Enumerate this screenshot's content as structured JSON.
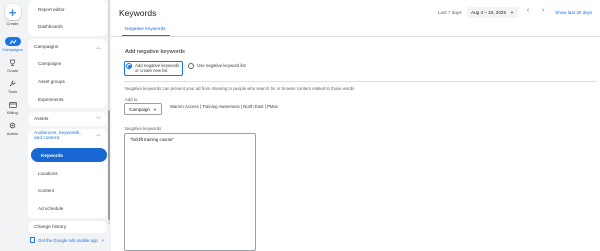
{
  "rail": {
    "create": "Create",
    "campaigns": "Campaigns",
    "goals": "Goals",
    "tools": "Tools",
    "billing": "Billing",
    "admin": "Admin"
  },
  "nav": {
    "top_items": [
      "Report editor",
      "Dashboards"
    ],
    "campaigns_section": "Campaigns",
    "campaigns_items": [
      "Campaigns",
      "Asset groups",
      "Experiments"
    ],
    "assets_section": "Assets",
    "akc_section": "Audiences, keywords, and content",
    "akc_items": [
      "Keywords",
      "Locations",
      "Content",
      "Ad schedule"
    ],
    "change_history": "Change history",
    "app_link": "Get the Google Ads mobile app"
  },
  "header": {
    "title": "Keywords",
    "date_range_label": "Last 7 days",
    "date_range_value": "Aug 4 – 10, 2025",
    "show_last_link": "Show last 30 days"
  },
  "tab": {
    "label": "Negative keywords"
  },
  "form": {
    "title": "Add negative keywords",
    "radio_add": "Add negative keywords or create new list",
    "radio_use": "Use negative keyword list",
    "description": "Negative keywords can prevent your ad from showing to people who search for or browse content related to those words",
    "add_to_label": "Add to",
    "campaign_select": "Campaign",
    "campaign_value": "Warren Access | Training Awareness | North East | PMax",
    "negative_keywords_label": "Negative keywords",
    "negative_keywords_value": "\"forklift training course\""
  },
  "colors": {
    "accent": "#1a73e8",
    "selected_nav": "#1967d2"
  }
}
